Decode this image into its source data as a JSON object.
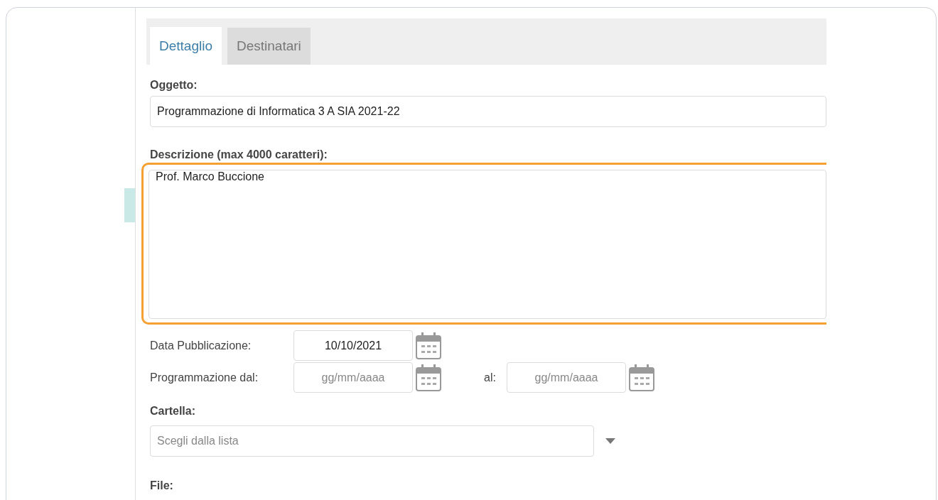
{
  "tabs": [
    {
      "label": "Dettaglio",
      "selected": true
    },
    {
      "label": "Destinatari",
      "selected": false
    }
  ],
  "subject": {
    "label": "Oggetto:",
    "value": "Programmazione di Informatica 3 A SIA 2021-22"
  },
  "description": {
    "label": "Descrizione (max 4000 caratteri):",
    "value": "Prof. Marco Buccione",
    "focused": true
  },
  "publication_date": {
    "label": "Data Pubblicazione:",
    "value": "10/10/2021"
  },
  "schedule": {
    "label": "Programmazione dal:",
    "from_placeholder": "gg/mm/aaaa",
    "to_label": "al:",
    "to_placeholder": "gg/mm/aaaa"
  },
  "folder": {
    "label": "Cartella:",
    "placeholder": "Scegli dalla lista"
  },
  "file": {
    "label": "File:"
  }
}
